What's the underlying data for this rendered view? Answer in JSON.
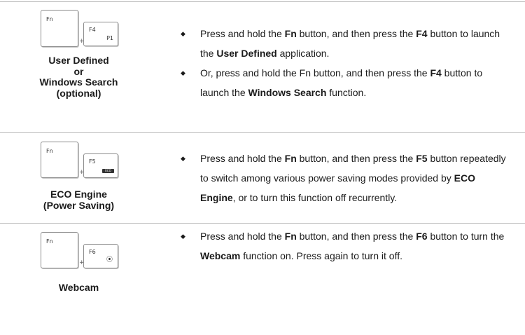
{
  "sections": [
    {
      "keys": {
        "fn": "Fn",
        "fkey": "F4",
        "fkey_sub": "P1"
      },
      "caption": [
        "User Defined",
        "or",
        "Windows Search",
        "(optional)"
      ],
      "bullets": [
        [
          {
            "t": "Press and hold the "
          },
          {
            "t": "Fn",
            "b": true
          },
          {
            "t": " button, and then press the "
          },
          {
            "t": "F4",
            "b": true
          },
          {
            "t": " button to launch the "
          },
          {
            "t": "User Defined",
            "b": true
          },
          {
            "t": " application."
          }
        ],
        [
          {
            "t": "Or, press and hold the Fn button, and then press the "
          },
          {
            "t": "F4",
            "b": true
          },
          {
            "t": " button to launch the "
          },
          {
            "t": "Windows Search",
            "b": true
          },
          {
            "t": " function."
          }
        ]
      ]
    },
    {
      "keys": {
        "fn": "Fn",
        "fkey": "F5",
        "fkey_icon": "eco-icon"
      },
      "caption": [
        "ECO Engine",
        "(Power Saving)"
      ],
      "bullets": [
        [
          {
            "t": "Press and hold the "
          },
          {
            "t": "Fn",
            "b": true
          },
          {
            "t": " button, and then press the "
          },
          {
            "t": "F5",
            "b": true
          },
          {
            "t": " button repeatedly to switch among various power saving modes provided by "
          },
          {
            "t": "ECO Engine",
            "b": true
          },
          {
            "t": ", or to turn this function off recurrently."
          }
        ]
      ]
    },
    {
      "keys": {
        "fn": "Fn",
        "fkey": "F6",
        "fkey_icon": "webcam-icon"
      },
      "caption": [
        "Webcam"
      ],
      "bullets": [
        [
          {
            "t": "Press and hold the "
          },
          {
            "t": "Fn",
            "b": true
          },
          {
            "t": " button, and then press the "
          },
          {
            "t": "F6",
            "b": true
          },
          {
            "t": " button to turn the "
          },
          {
            "t": "Webcam",
            "b": true
          },
          {
            "t": " function on. Press again to turn it off."
          }
        ]
      ]
    }
  ]
}
